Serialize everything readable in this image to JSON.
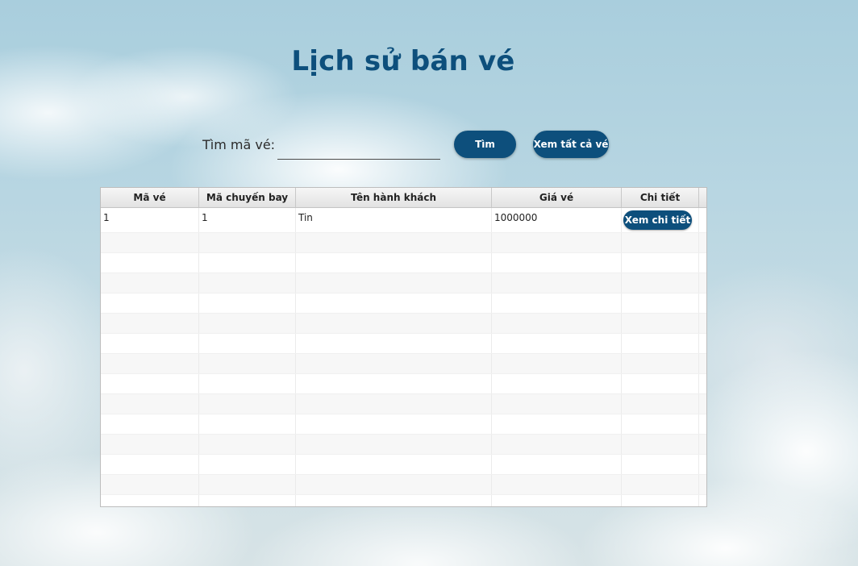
{
  "header": {
    "title": "Lịch sử bán vé"
  },
  "search": {
    "label": "Tìm mã vé:",
    "value": "",
    "placeholder": "",
    "search_button": "Tìm",
    "view_all_button": "Xem tất cả vé"
  },
  "table": {
    "columns": [
      "Mã vé",
      "Mã chuyến bay",
      "Tên hành khách",
      "Giá vé",
      "Chi tiết"
    ],
    "rows": [
      {
        "ma_ve": "1",
        "ma_chuyen_bay": "1",
        "ten_hanh_khach": "Tin",
        "gia_ve": "1000000",
        "action_label": "Xem chi tiết"
      }
    ]
  }
}
